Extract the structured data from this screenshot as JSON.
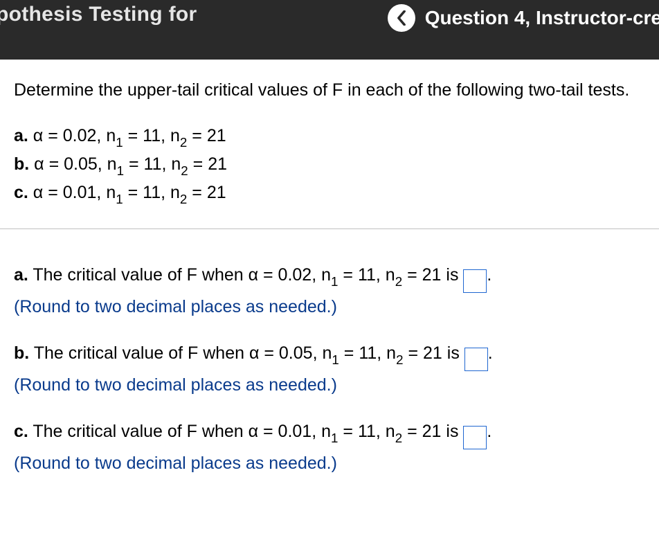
{
  "header": {
    "title_visible": "pothesis Testing for",
    "question_label_visible": "Question 4, Instructor-cre"
  },
  "problem": {
    "prompt": "Determine the upper-tail critical values of F in each of the following two-tail tests.",
    "parts": [
      {
        "label": "a.",
        "alpha": "0.02",
        "n1": "11",
        "n2": "21"
      },
      {
        "label": "b.",
        "alpha": "0.05",
        "n1": "11",
        "n2": "21"
      },
      {
        "label": "c.",
        "alpha": "0.01",
        "n1": "11",
        "n2": "21"
      }
    ],
    "hint": "(Round to two decimal places as needed.)",
    "answer_lead": "The critical value of F when",
    "is_word": "is",
    "period": "."
  }
}
